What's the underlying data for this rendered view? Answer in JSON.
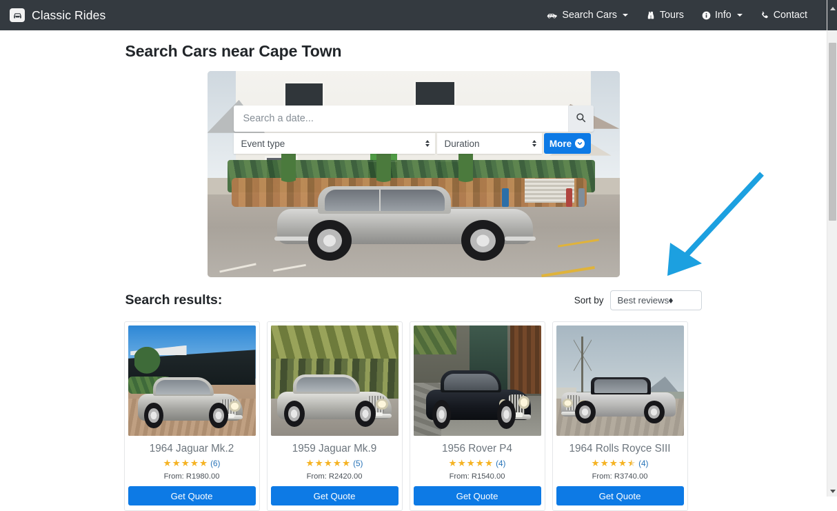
{
  "navbar": {
    "brand": "Classic Rides",
    "brand_icon": "car-icon",
    "items": [
      {
        "label": "Search Cars",
        "icon": "car-side-icon",
        "has_caret": true
      },
      {
        "label": "Tours",
        "icon": "binoculars-icon",
        "has_caret": false
      },
      {
        "label": "Info",
        "icon": "info-circle-icon",
        "has_caret": true
      },
      {
        "label": "Contact",
        "icon": "phone-icon",
        "has_caret": false
      }
    ],
    "background": "#343a40"
  },
  "page": {
    "title": "Search Cars near Cape Town"
  },
  "hero": {
    "alt": "Silver classic Jaguar parked in front of a white Cape Dutch building"
  },
  "search": {
    "date_placeholder": "Search a date...",
    "date_value": "",
    "search_icon": "magnifier-icon",
    "event_type": "Event type",
    "duration": "Duration",
    "more_label": "More",
    "more_icon": "chevron-down-circle-icon",
    "accent": "#0d7ae5"
  },
  "results": {
    "heading": "Search results:",
    "sort_label": "Sort by",
    "sort_value": "Best reviews",
    "cards": [
      {
        "title": "1964 Jaguar Mk.2",
        "rating": 5,
        "reviews": "(6)",
        "price": "From: R1980.00",
        "button": "Get Quote",
        "image_alt": "1964 Jaguar Mk.2 silver saloon on brick paving"
      },
      {
        "title": "1959 Jaguar Mk.9",
        "rating": 5,
        "reviews": "(5)",
        "price": "From: R2420.00",
        "button": "Get Quote",
        "image_alt": "1959 Jaguar Mk.9 silver saloon on tree-lined avenue"
      },
      {
        "title": "1956 Rover P4",
        "rating": 5,
        "reviews": "(4)",
        "price": "From: R1540.00",
        "button": "Get Quote",
        "image_alt": "1956 Rover P4 black saloon on a wet street"
      },
      {
        "title": "1964 Rolls Royce SIII",
        "rating": 4.5,
        "reviews": "(4)",
        "price": "From: R3740.00",
        "button": "Get Quote",
        "image_alt": "1964 Rolls Royce Silver Cloud III with mountains behind"
      }
    ]
  },
  "annotation": {
    "type": "arrow",
    "color": "#1ca0e0",
    "points_to": "sort-by-select"
  },
  "scrollbar": {
    "orientation": "vertical"
  }
}
